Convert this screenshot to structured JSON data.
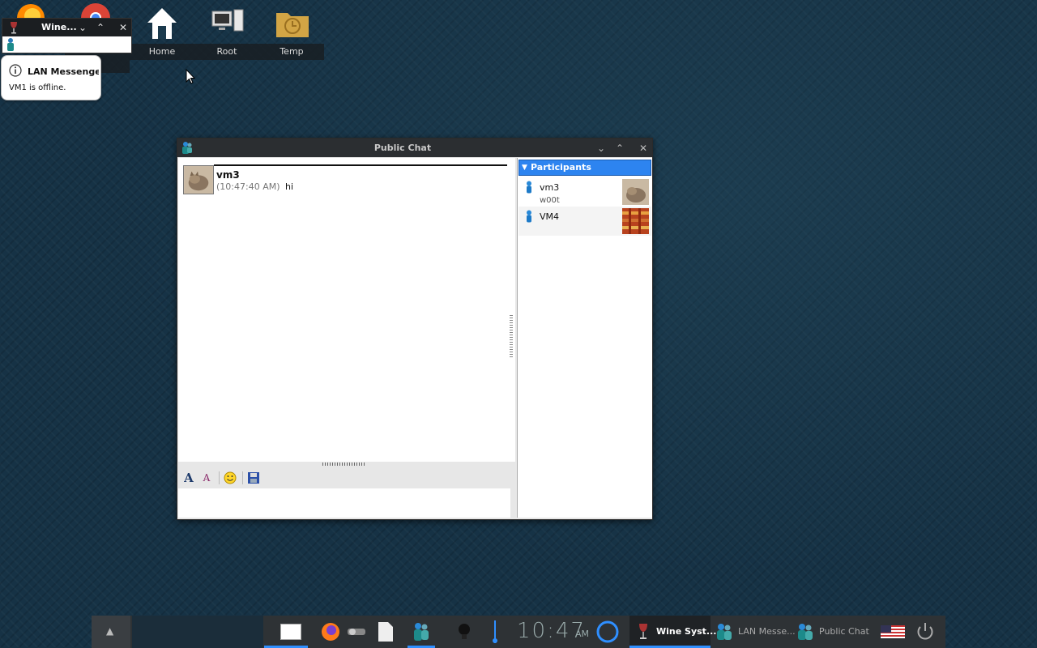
{
  "desktop": {
    "icons": [
      {
        "label": "Home"
      },
      {
        "label": "Root"
      },
      {
        "label": "Temp"
      }
    ],
    "partial_labels": [
      "Firefox",
      "Google Chrome"
    ]
  },
  "wine_window": {
    "title": "Wine...",
    "controls": {
      "down": "⌄",
      "up": "⌃",
      "close": "✕"
    }
  },
  "notification": {
    "title": "LAN Messenger",
    "body": "VM1 is offline."
  },
  "chat_window": {
    "title": "Public Chat",
    "message": {
      "sender": "vm3",
      "timestamp": "(10:47:40 AM)",
      "text": "hi"
    },
    "input_value": "",
    "participants_header": "Participants",
    "participants": [
      {
        "name": "vm3",
        "status": "w00t"
      },
      {
        "name": "VM4",
        "status": ""
      }
    ]
  },
  "taskbar": {
    "clock": "10:47",
    "ampm": "AM",
    "tasks": [
      {
        "label": "Wine Syst..."
      },
      {
        "label": "LAN Messe..."
      },
      {
        "label": "Public Chat"
      }
    ]
  },
  "colors": {
    "accent": "#2f8fff",
    "participants_header": "#2d84f0",
    "titlebar": "#2b2e31"
  }
}
